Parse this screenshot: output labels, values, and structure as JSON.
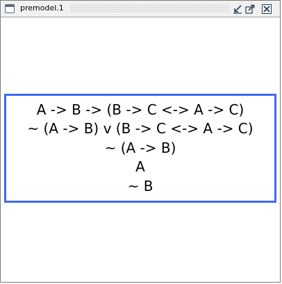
{
  "window": {
    "title": "premodel.1"
  },
  "formulas": [
    "A -> B -> (B -> C <-> A -> C)",
    "~ (A -> B) v (B -> C <-> A -> C)",
    "~ (A -> B)",
    "A",
    "~ B"
  ],
  "colors": {
    "box_border": "#3d6bf0",
    "titlebar_bg": "#f1f1f1",
    "window_border": "#7a7a7a"
  },
  "icons": {
    "window": "window-icon",
    "iconify": "iconify-icon",
    "maximize": "maximize-icon",
    "close": "close-icon"
  }
}
